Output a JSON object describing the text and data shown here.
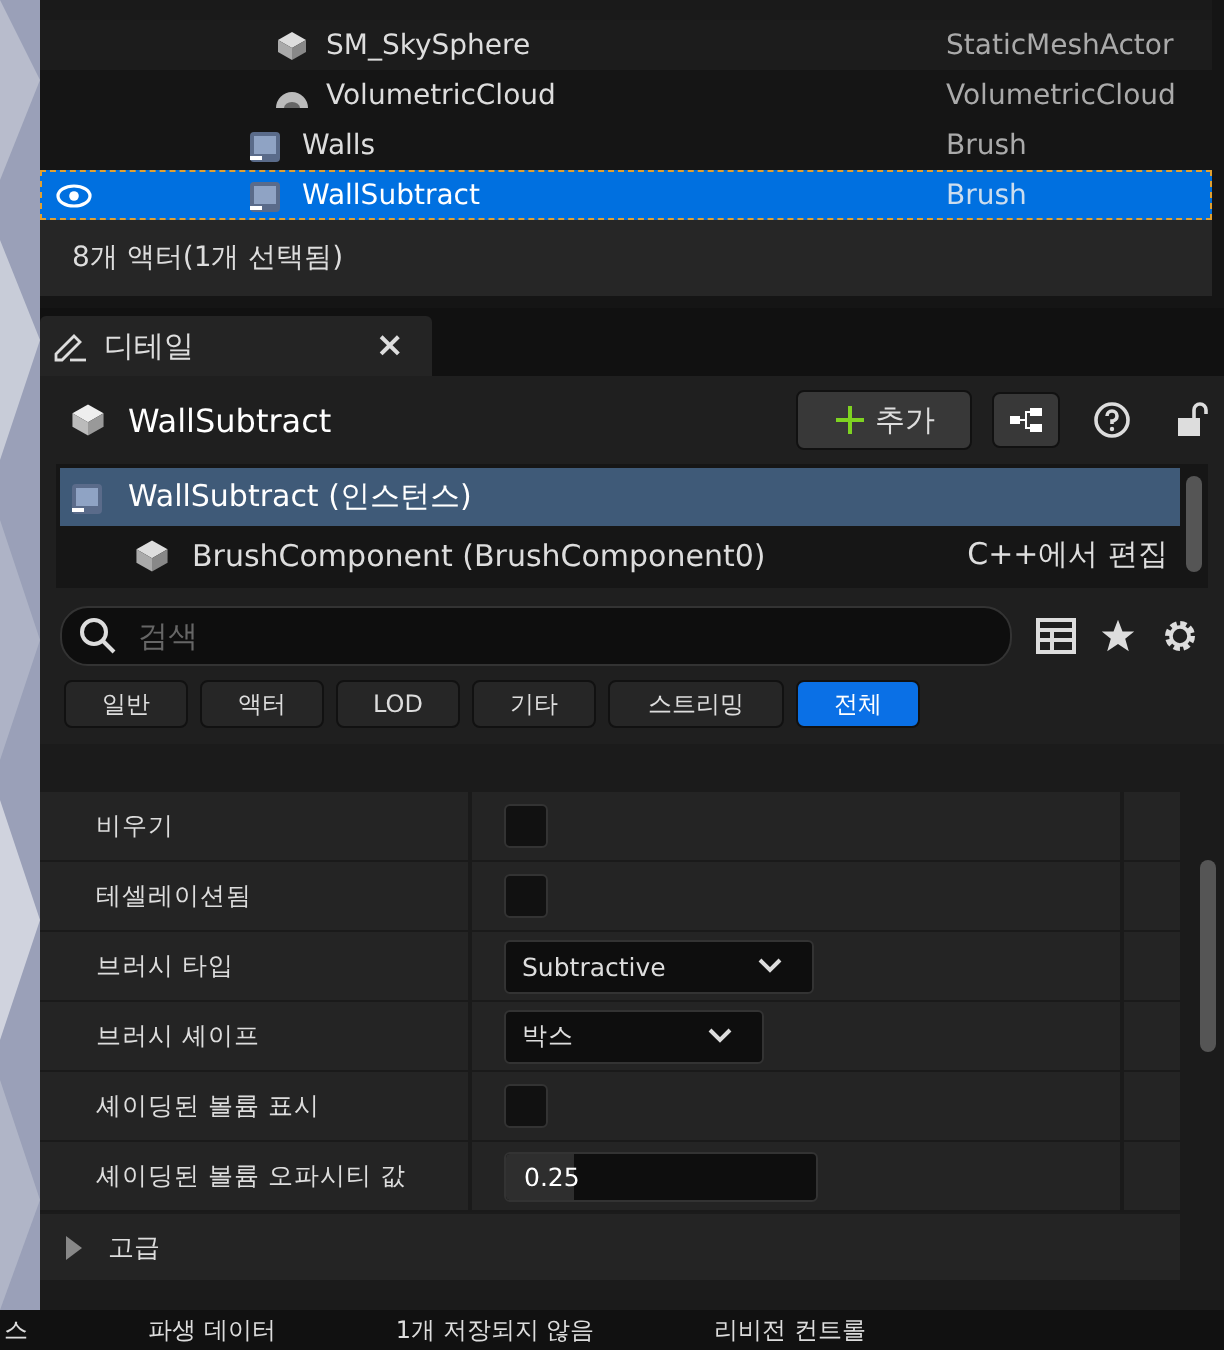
{
  "outliner": {
    "nested_rows": [
      {
        "label": "SM_SkySphere",
        "type": "StaticMeshActor",
        "kind": "mesh",
        "selected": false
      },
      {
        "label": "VolumetricCloud",
        "type": "VolumetricCloud",
        "kind": "cloud",
        "selected": false
      }
    ],
    "rows": [
      {
        "label": "Walls",
        "type": "Brush",
        "kind": "brush",
        "selected": false
      },
      {
        "label": "WallSubtract",
        "type": "Brush",
        "kind": "brush",
        "selected": true
      }
    ],
    "summary": "8개 액터(1개 선택됨)"
  },
  "details": {
    "tab": {
      "label": "디테일",
      "close": "×"
    },
    "title": "WallSubtract",
    "add_button": "추가",
    "components": [
      {
        "label": "WallSubtract (인스턴스)",
        "selected": true
      },
      {
        "label": "BrushComponent (BrushComponent0)",
        "action": "C++에서 편집",
        "selected": false
      }
    ],
    "search": {
      "placeholder": "검색"
    },
    "filters": [
      {
        "label": "일반",
        "selected": false
      },
      {
        "label": "액터",
        "selected": false
      },
      {
        "label": "LOD",
        "selected": false
      },
      {
        "label": "기타",
        "selected": false
      },
      {
        "label": "스트리밍",
        "selected": false
      },
      {
        "label": "전체",
        "selected": true
      }
    ],
    "properties": [
      {
        "label": "비우기",
        "kind": "checkbox",
        "checked": false
      },
      {
        "label": "테셀레이션됨",
        "kind": "checkbox",
        "checked": false
      },
      {
        "label": "브러시 타입",
        "kind": "dropdown",
        "value": "Subtractive"
      },
      {
        "label": "브러시 셰이프",
        "kind": "dropdown",
        "value": "박스"
      },
      {
        "label": "셰이딩된 볼륨 표시",
        "kind": "checkbox",
        "checked": false
      },
      {
        "label": "셰이딩된 볼륨 오파시티 값",
        "kind": "number",
        "value": "0.25",
        "level": 0.22
      }
    ],
    "section": {
      "label": "고급",
      "expanded": false
    }
  },
  "status_bar": [
    "스",
    "파생 데이터",
    "1개 저장되지 않음",
    "리비전 컨트롤"
  ]
}
